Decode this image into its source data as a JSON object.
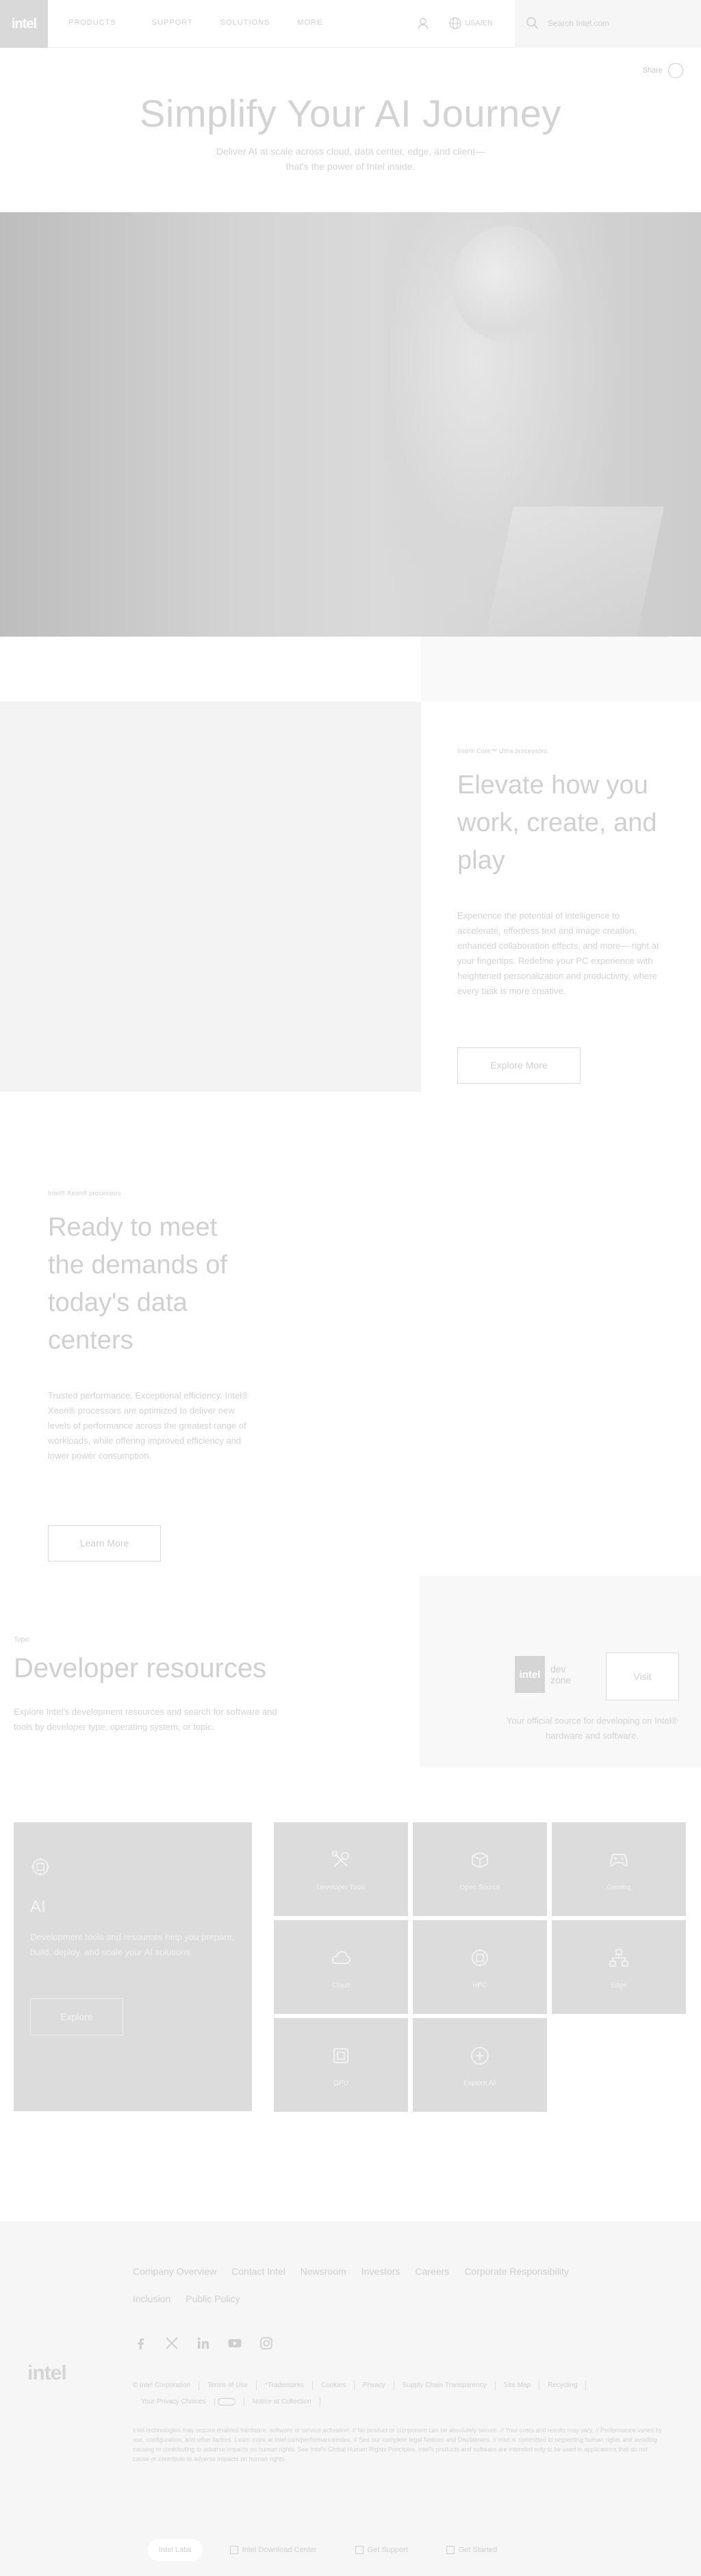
{
  "header": {
    "logo": "intel",
    "nav": [
      "PRODUCTS",
      "SUPPORT",
      "SOLUTIONS",
      "MORE"
    ],
    "lang_label": "USA/EN",
    "search_placeholder": "Search Intel.com"
  },
  "hero": {
    "share_label": "Share",
    "title": "Simplify Your AI Journey",
    "subtitle": "Deliver AI at scale across cloud, data center, edge, and client—that's the power of Intel inside."
  },
  "elevate": {
    "eyebrow": "Intel® Core™ Ultra processors",
    "title": "Elevate how you work, create, and play",
    "body": "Experience the potential of intelligence to accelerate, effortless text and image creation, enhanced collaboration effects, and more— right at your fingertips. Redefine your PC experience with heightened personalization and productivity, where every task is more creative.",
    "button": "Explore More"
  },
  "ready": {
    "eyebrow": "Intel® Xeon® processors",
    "title": "Ready to meet the demands of today's data centers",
    "body": "Trusted performance. Exceptional efficiency. Intel® Xeon® processors are optimized to deliver new levels of performance across the greatest range of workloads, while offering improved efficiency and lower power consumption.",
    "button": "Learn More"
  },
  "developer": {
    "eyebrow": "Topic",
    "title": "Developer resources",
    "body": "Explore Intel's development resources and search for software and tools by developer type, operating system, or topic.",
    "devzone_logo_box": "intel",
    "devzone_logo_text": "dev zone",
    "devzone_button": "Visit",
    "devzone_caption": "Your official source for developing on Intel® hardware and software."
  },
  "ai_card": {
    "icon": "ai-chip-icon",
    "title": "AI",
    "body": "Development tools and resources help you prepare, build, deploy, and scale your AI solutions.",
    "button": "Explore"
  },
  "tiles": [
    {
      "label": "Developer Tools",
      "icon": "tools-icon"
    },
    {
      "label": "Open Source",
      "icon": "open-source-icon"
    },
    {
      "label": "Gaming",
      "icon": "gamepad-icon"
    },
    {
      "label": "Cloud",
      "icon": "cloud-icon"
    },
    {
      "label": "HPC",
      "icon": "hpc-chip-icon"
    },
    {
      "label": "Edge",
      "icon": "network-icon"
    },
    {
      "label": "GPU",
      "icon": "gpu-icon"
    },
    {
      "label": "Explore All",
      "icon": "plus-circle-icon"
    }
  ],
  "footer": {
    "links": [
      "Company Overview",
      "Contact Intel",
      "Newsroom",
      "Investors",
      "Careers",
      "Corporate Responsibility",
      "Inclusion",
      "Public Policy"
    ],
    "social": [
      "facebook-icon",
      "x-icon",
      "linkedin-icon",
      "youtube-icon",
      "instagram-icon"
    ],
    "logo": "intel",
    "legal": [
      "© Intel Corporation",
      "Terms of Use",
      "*Trademarks",
      "Cookies",
      "Privacy",
      "Supply Chain Transparency",
      "Site Map",
      "Recycling",
      "Your Privacy Choices",
      "Notice at Collection"
    ],
    "note": "Intel technologies may require enabled hardware, software or service activation. // No product or component can be absolutely secure. // Your costs and results may vary. // Performance varies by use, configuration, and other factors. Learn more at intel.com/performanceindex. // See our complete legal Notices and Disclaimers. // Intel is committed to respecting human rights and avoiding causing or contributing to adverse impacts on human rights. See Intel's Global Human Rights Principles. Intel's products and software are intended only to be used in applications that do not cause or contribute to adverse impacts on human rights.",
    "bottom_bar": [
      "Intel Labs",
      "Intel Download Center",
      "Get Support",
      "Get Started"
    ]
  }
}
